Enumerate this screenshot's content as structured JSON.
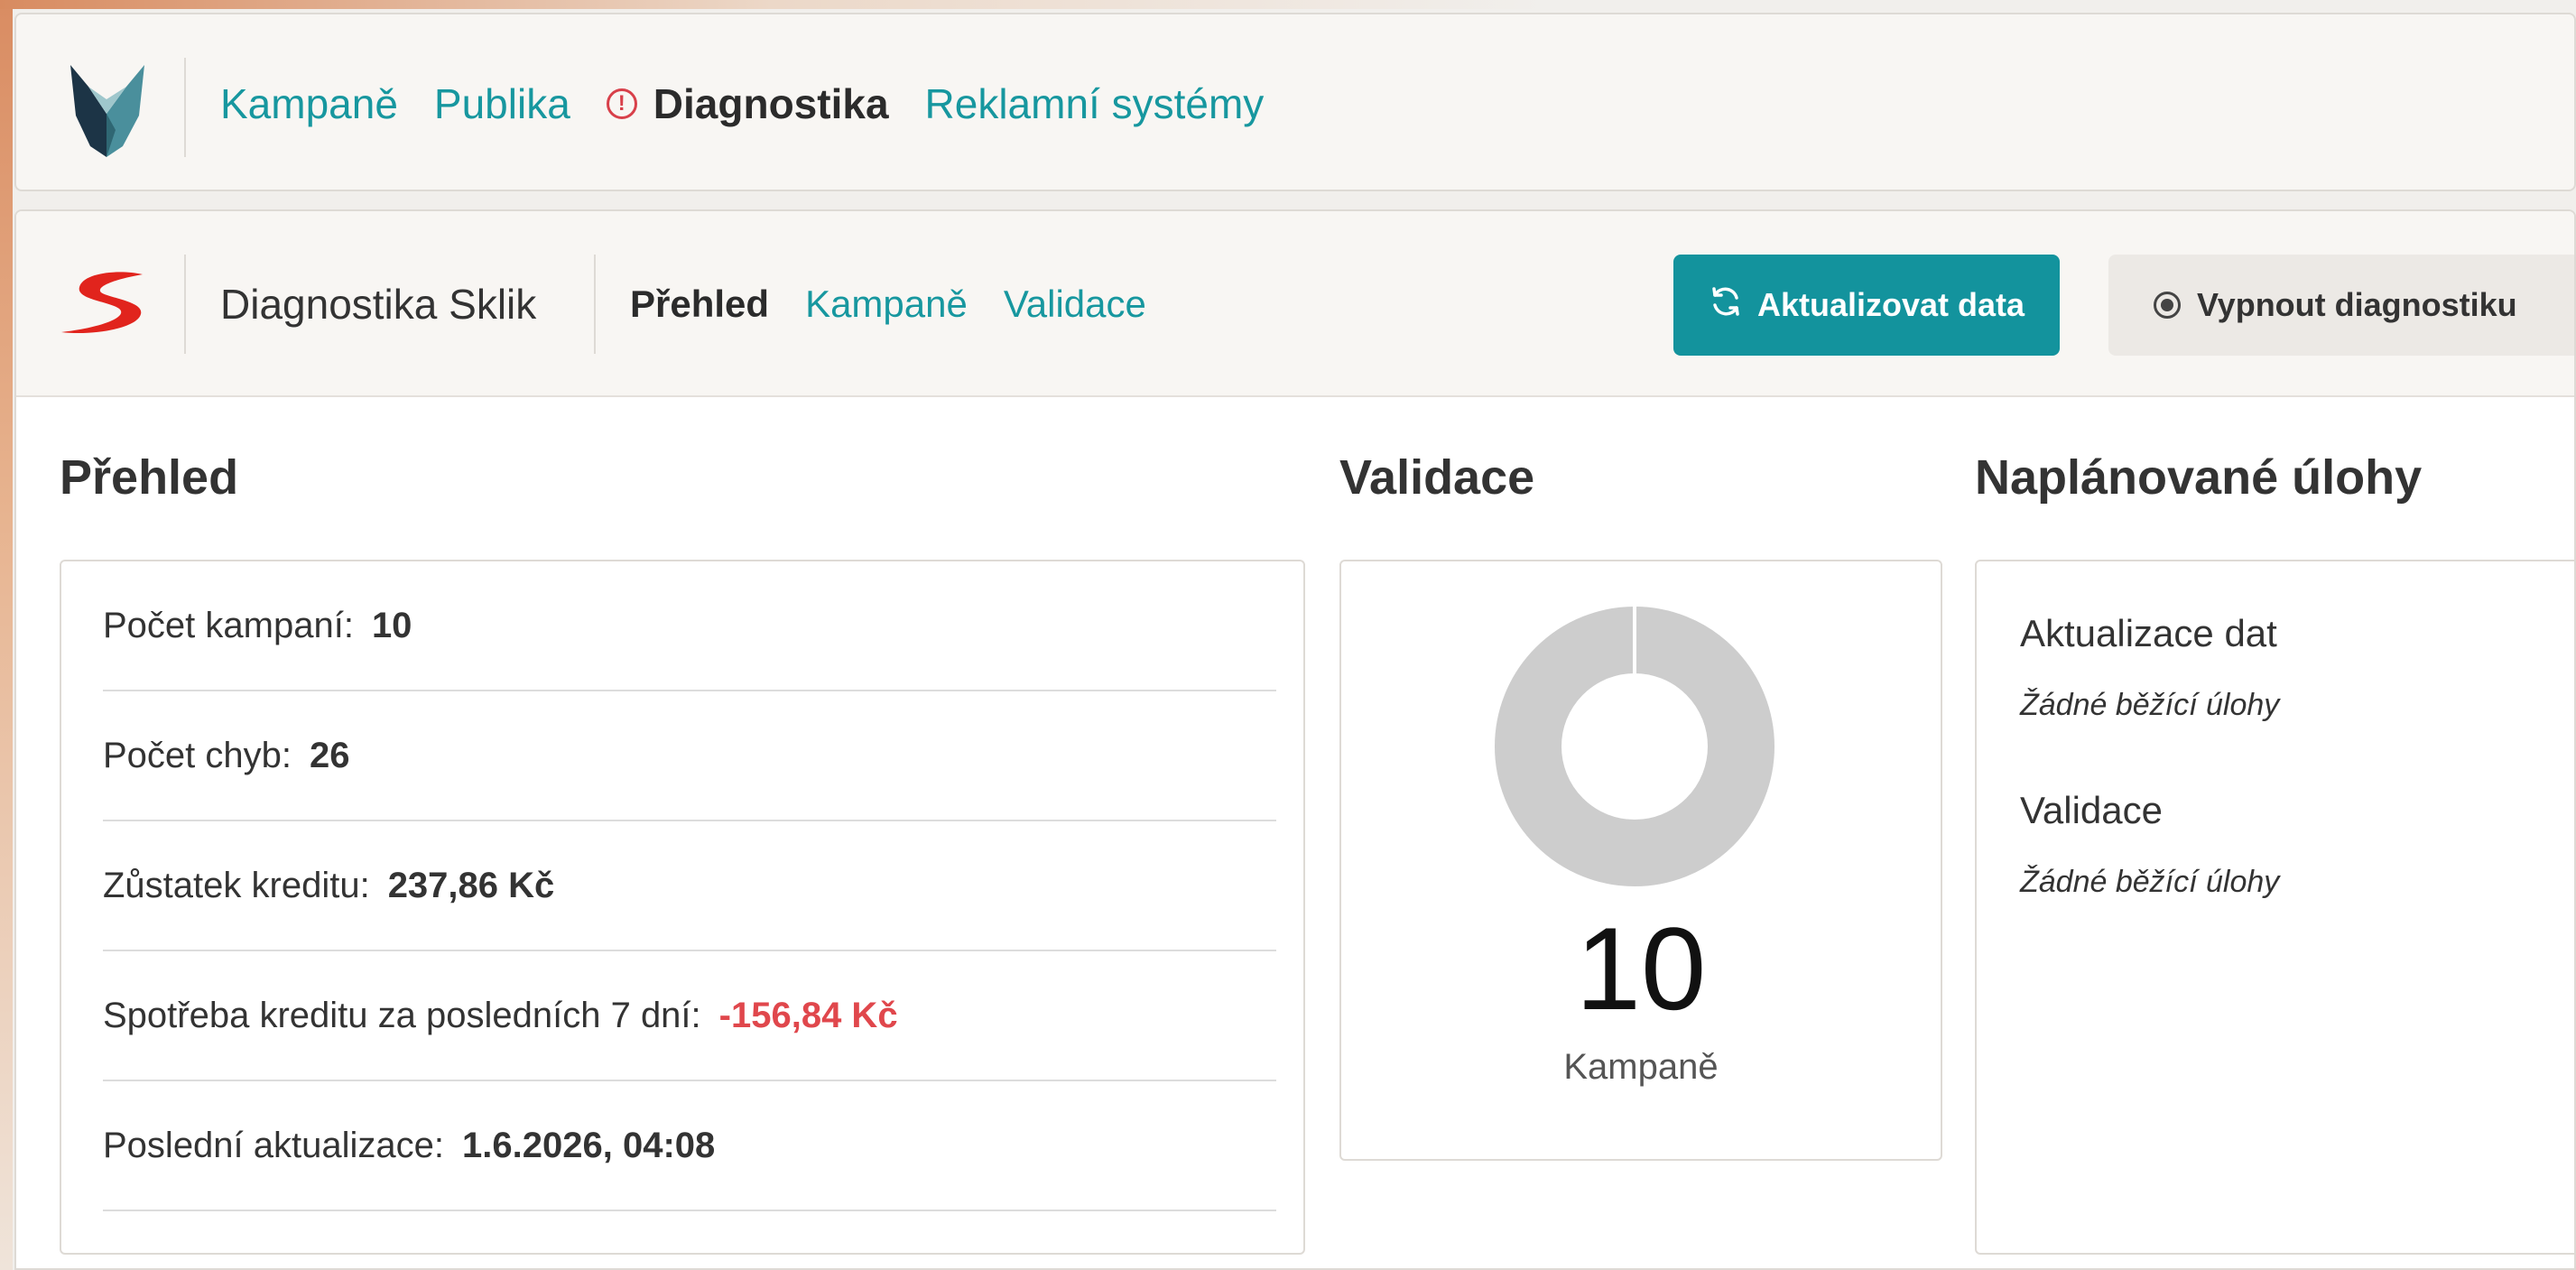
{
  "topnav": {
    "logo": "fox-logo",
    "items": [
      {
        "label": "Kampaně",
        "active": false
      },
      {
        "label": "Publika",
        "active": false
      },
      {
        "label": "Diagnostika",
        "active": true,
        "icon": "alert-circle-icon"
      },
      {
        "label": "Reklamní systémy",
        "active": false
      }
    ]
  },
  "subheader": {
    "logo": "sklik-logo",
    "title": "Diagnostika Sklik",
    "tabs": [
      {
        "label": "Přehled",
        "active": true
      },
      {
        "label": "Kampaně",
        "active": false
      },
      {
        "label": "Validace",
        "active": false
      }
    ],
    "refresh_button": {
      "label": "Aktualizovat data",
      "icon": "refresh-icon"
    },
    "disable_button": {
      "label": "Vypnout diagnostiku",
      "icon": "radio-icon"
    }
  },
  "overview": {
    "title": "Přehled",
    "stats": [
      {
        "label": "Počet kampaní:",
        "value": "10"
      },
      {
        "label": "Počet chyb:",
        "value": "26"
      },
      {
        "label": "Zůstatek kreditu:",
        "value": "237,86 Kč"
      },
      {
        "label": "Spotřeba kreditu za posledních 7 dní:",
        "value": "-156,84 Kč",
        "status": "negative"
      },
      {
        "label": "Poslední aktualizace:",
        "value": "1.6.2026, 04:08"
      }
    ]
  },
  "validation": {
    "title": "Validace",
    "count": "10",
    "label": "Kampaně"
  },
  "chart_data": {
    "type": "pie",
    "donut": true,
    "values": [
      10
    ],
    "colors": [
      "#cdcdcd"
    ]
  },
  "tasks": {
    "title": "Naplánované úlohy",
    "items": [
      {
        "title": "Aktualizace dat",
        "status": "Žádné běžící úlohy"
      },
      {
        "title": "Validace",
        "status": "Žádné běžící úlohy"
      }
    ]
  },
  "colors": {
    "accent": "#13939d",
    "link": "#17979f",
    "error": "#e0474c",
    "alert": "#d8404a",
    "sklik_red": "#e1241d"
  }
}
